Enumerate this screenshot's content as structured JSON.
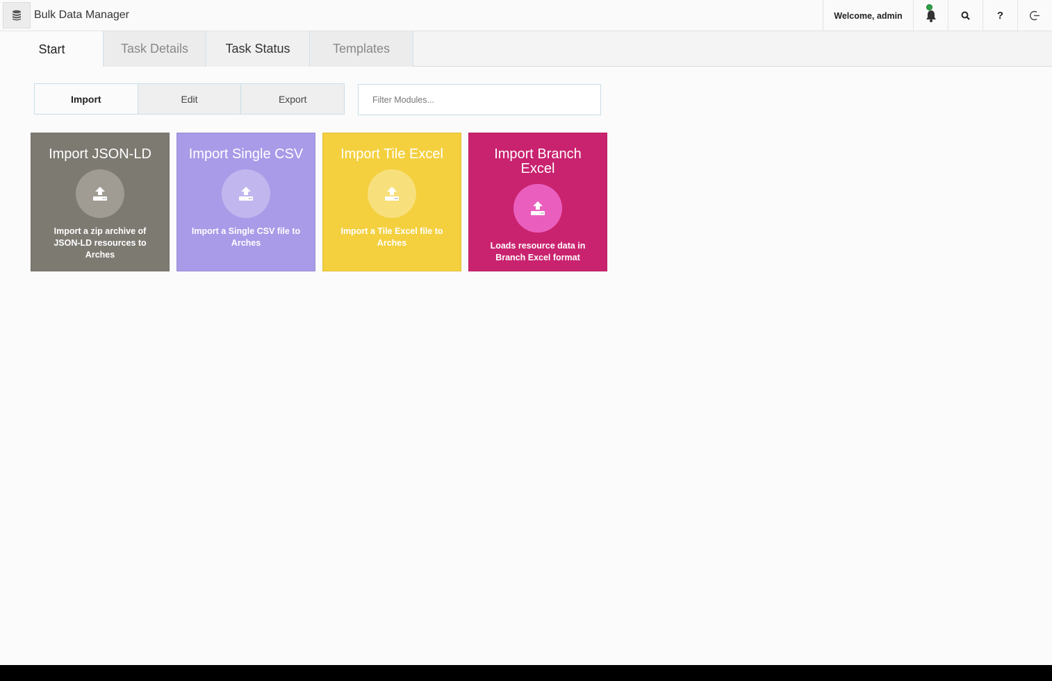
{
  "header": {
    "app_title": "Bulk Data Manager",
    "welcome": "Welcome, admin",
    "icons": [
      "database-icon",
      "bell-icon",
      "search-icon",
      "help-icon",
      "logout-icon"
    ],
    "help_glyph": "?"
  },
  "tabs": [
    {
      "label": "Start",
      "state": "active"
    },
    {
      "label": "Task Details",
      "state": "inactive"
    },
    {
      "label": "Task Status",
      "state": "inactive"
    },
    {
      "label": "Templates",
      "state": "inactive"
    }
  ],
  "segment": {
    "import": "Import",
    "edit": "Edit",
    "export": "Export",
    "selected": "Import"
  },
  "filter": {
    "placeholder": "Filter Modules..."
  },
  "cards": [
    {
      "title": "Import JSON-LD",
      "description": "Import a zip archive of JSON-LD resources to Arches",
      "color": "#7d7a72",
      "circle": "#a09c93",
      "icon": "upload-icon"
    },
    {
      "title": "Import Single CSV",
      "description": "Import a Single CSV file to Arches",
      "color": "#a99be8",
      "circle": "#c1b7ee",
      "icon": "upload-icon"
    },
    {
      "title": "Import Tile Excel",
      "description": "Import a Tile Excel file to Arches",
      "color": "#f4d03f",
      "circle": "#f7e07c",
      "icon": "upload-icon"
    },
    {
      "title": "Import Branch Excel",
      "description": "Loads resource data in Branch Excel format",
      "color": "#c9236f",
      "circle": "#ea5fbe",
      "icon": "upload-icon"
    }
  ]
}
